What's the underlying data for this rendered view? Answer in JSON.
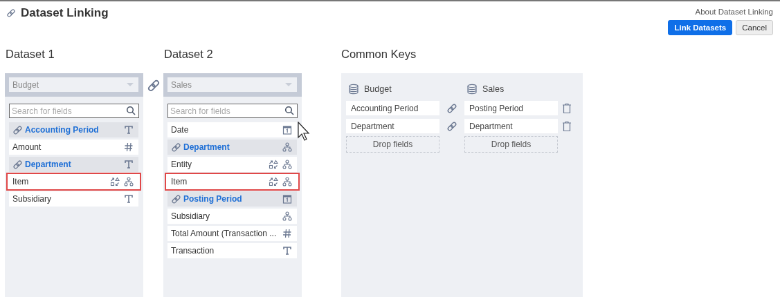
{
  "title": "Dataset Linking",
  "about_link": "About Dataset Linking",
  "buttons": [
    {
      "label": "Link Datasets",
      "kind": "primary"
    },
    {
      "label": "Cancel",
      "kind": "secondary"
    }
  ],
  "datasets": [
    {
      "heading": "Dataset 1",
      "selected_dataset": "Budget",
      "search": {
        "placeholder": "Search for fields"
      },
      "fields": [
        {
          "name": "Accounting Period",
          "linked": true,
          "highlighted": false,
          "icons": [
            {
              "kind": "text"
            }
          ]
        },
        {
          "name": "Amount",
          "linked": false,
          "highlighted": false,
          "icons": [
            {
              "kind": "number"
            }
          ]
        },
        {
          "name": "Department",
          "linked": true,
          "highlighted": false,
          "icons": [
            {
              "kind": "text"
            }
          ]
        },
        {
          "name": "Item",
          "linked": false,
          "highlighted": true,
          "icons": [
            {
              "kind": "convert"
            },
            {
              "kind": "hierarchy"
            }
          ]
        },
        {
          "name": "Subsidiary",
          "linked": false,
          "highlighted": false,
          "icons": [
            {
              "kind": "text"
            }
          ]
        }
      ]
    },
    {
      "heading": "Dataset 2",
      "selected_dataset": "Sales",
      "search": {
        "placeholder": "Search for fields"
      },
      "fields": [
        {
          "name": "Date",
          "linked": false,
          "highlighted": false,
          "icons": [
            {
              "kind": "date"
            }
          ]
        },
        {
          "name": "Department",
          "linked": true,
          "highlighted": false,
          "icons": [
            {
              "kind": "hierarchy"
            }
          ]
        },
        {
          "name": "Entity",
          "linked": false,
          "highlighted": false,
          "icons": [
            {
              "kind": "convert"
            },
            {
              "kind": "hierarchy"
            }
          ]
        },
        {
          "name": "Item",
          "linked": false,
          "highlighted": true,
          "icons": [
            {
              "kind": "convert"
            },
            {
              "kind": "hierarchy"
            }
          ]
        },
        {
          "name": "Posting Period",
          "linked": true,
          "highlighted": false,
          "icons": [
            {
              "kind": "date"
            }
          ]
        },
        {
          "name": "Subsidiary",
          "linked": false,
          "highlighted": false,
          "icons": [
            {
              "kind": "hierarchy"
            }
          ]
        },
        {
          "name": "Total Amount (Transaction ...",
          "linked": false,
          "highlighted": false,
          "icons": [
            {
              "kind": "number"
            }
          ]
        },
        {
          "name": "Transaction",
          "linked": false,
          "highlighted": false,
          "icons": [
            {
              "kind": "text"
            }
          ]
        }
      ]
    }
  ],
  "common_keys": {
    "heading": "Common Keys",
    "columns": [
      {
        "dataset": "Budget",
        "keys": [
          "Accounting Period",
          "Department"
        ],
        "drop_label": "Drop fields"
      },
      {
        "dataset": "Sales",
        "keys": [
          "Posting Period",
          "Department"
        ],
        "drop_label": "Drop fields"
      }
    ]
  }
}
